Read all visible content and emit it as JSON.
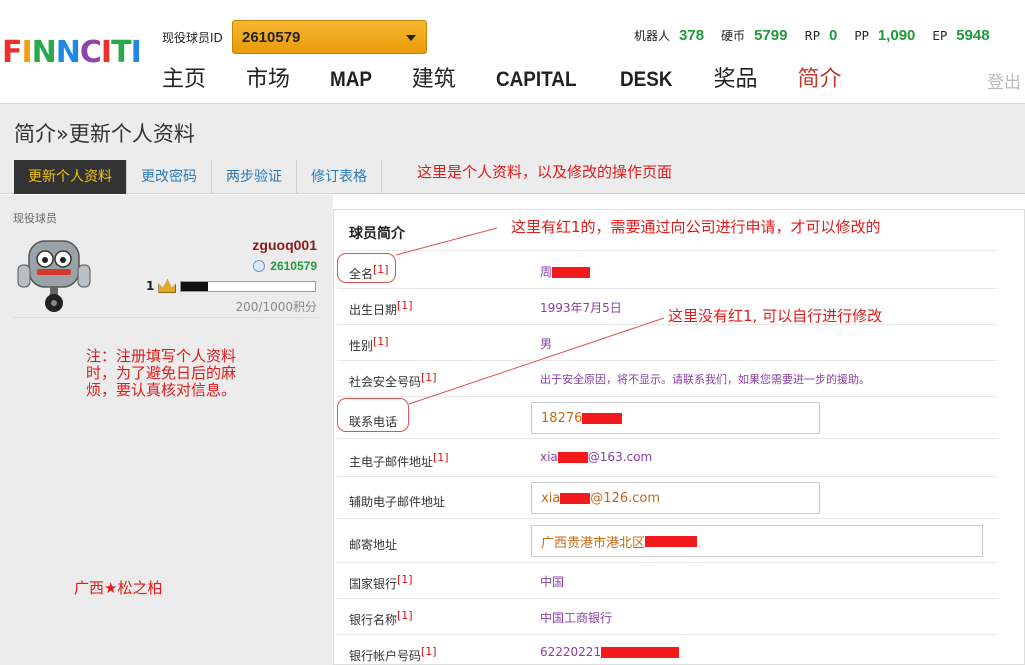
{
  "header": {
    "logo_text": "FINNCITI",
    "id_label": "现役球员ID",
    "selected_id": "2610579",
    "stats": [
      {
        "label": "机器人",
        "value": "378"
      },
      {
        "label": "硬币",
        "value": "5799"
      },
      {
        "label": "RP",
        "value": "0"
      },
      {
        "label": "PP",
        "value": "1,090"
      },
      {
        "label": "EP",
        "value": "5948"
      }
    ],
    "nav": [
      "主页",
      "市场",
      "MAP",
      "建筑",
      "CAPITAL",
      "DESK",
      "奖品",
      "简介"
    ],
    "logout": "登出"
  },
  "page": {
    "title": "简介»更新个人资料",
    "tabs": [
      "更新个人资料",
      "更改密码",
      "两步验证",
      "修订表格"
    ]
  },
  "player": {
    "status_label": "现役球员",
    "username": "zguoq001",
    "id": "2610579",
    "level": "1",
    "progress_fraction": 0.2,
    "points": "200/1000积分"
  },
  "profile": {
    "section_title": "球员简介",
    "fields": [
      {
        "label": "全名",
        "mark": "[1]",
        "value": "周"
      },
      {
        "label": "出生日期",
        "mark": "[1]",
        "value": "1993年7月5日"
      },
      {
        "label": "性别",
        "mark": "[1]",
        "value": "男"
      },
      {
        "label": "社会安全号码",
        "mark": "[1]",
        "value": "出于安全原因，将不显示。请联系我们，如果您需要进一步的援助。"
      },
      {
        "label": "联系电话",
        "mark": "",
        "value": "18276"
      },
      {
        "label": "主电子邮件地址",
        "mark": "[1]",
        "value": "xia",
        "value_suffix": "@163.com"
      },
      {
        "label": "辅助电子邮件地址",
        "mark": "",
        "value": "xia",
        "value_suffix": "@126.com"
      },
      {
        "label": "邮寄地址",
        "mark": "",
        "value": "广西贵港市港北区"
      },
      {
        "label": "国家银行",
        "mark": "[1]",
        "value": "中国"
      },
      {
        "label": "银行名称",
        "mark": "[1]",
        "value": "中国工商银行"
      },
      {
        "label": "银行帐户号码",
        "mark": "[1]",
        "value": "62220221"
      }
    ]
  },
  "annotations": {
    "top": "这里是个人资料，以及修改的操作页面",
    "red1": "这里有红1的，需要通过向公司进行申请，才可以修改的",
    "no_red1": "这里没有红1, 可以自行进行修改",
    "note": "注：注册填写个人资料时，为了避免日后的麻烦，要认真核对信息。",
    "signature": "广西★松之柏"
  },
  "colors": {
    "accent_red": "#e01b1b",
    "stat_green": "#1f9a3a",
    "value_purple": "#8a3fa8",
    "tab_active_bg": "#333333",
    "tab_active_text": "#f1c40f"
  }
}
